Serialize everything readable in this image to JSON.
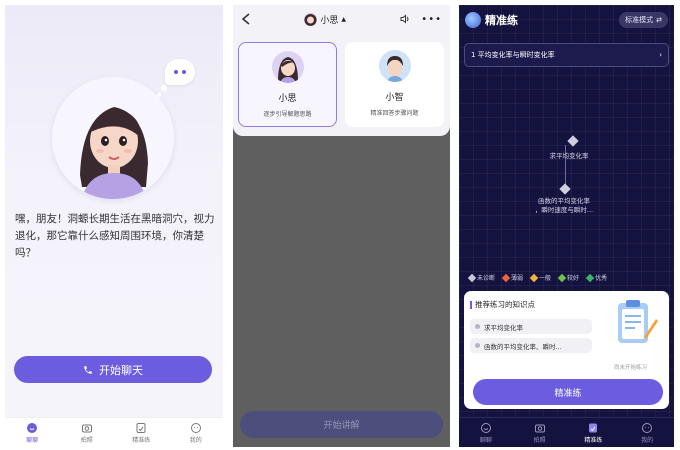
{
  "panel1": {
    "intro_text": "嘿，朋友！洞螈长期生活在黑暗洞穴，视力退化，那它靠什么感知周围环境，你清楚吗？",
    "start_chat_label": "开始聊天",
    "tabs": [
      {
        "label": "聊聊",
        "icon": "chat-icon",
        "active": true
      },
      {
        "label": "拍照",
        "icon": "camera-icon",
        "active": false
      },
      {
        "label": "精准练",
        "icon": "practice-icon",
        "active": false
      },
      {
        "label": "我的",
        "icon": "profile-icon",
        "active": false
      }
    ]
  },
  "panel2": {
    "nav_title": "小思",
    "tutors": [
      {
        "name": "小思",
        "desc": "逐步引导解题思路",
        "selected": true
      },
      {
        "name": "小智",
        "desc": "精准回答步骤问题",
        "selected": false
      }
    ],
    "start_label": "开始讲解"
  },
  "panel3": {
    "title": "精准练",
    "mode_label": "标准模式",
    "chapter": "1 平均变化率与瞬时变化率",
    "node1_label": "求平均变化率",
    "node2_label_line1": "函数的平均变化率",
    "node2_label_line2": "，瞬时速度与瞬时...",
    "legend": [
      {
        "label": "未诊断",
        "color": "#c9c9d6"
      },
      {
        "label": "薄弱",
        "color": "#e8643c"
      },
      {
        "label": "一般",
        "color": "#f0b63a"
      },
      {
        "label": "较好",
        "color": "#6cc24a"
      },
      {
        "label": "优秀",
        "color": "#39b36b"
      }
    ],
    "recommend_title": "推荐练习的知识点",
    "recommend_items": [
      "求平均变化率",
      "函数的平均变化率、瞬时..."
    ],
    "recommend_note": "尚未开始练习",
    "practice_button": "精准练",
    "tabs": [
      {
        "label": "聊聊",
        "icon": "chat-icon",
        "active": false
      },
      {
        "label": "拍照",
        "icon": "camera-icon",
        "active": false
      },
      {
        "label": "精准练",
        "icon": "practice-icon",
        "active": true
      },
      {
        "label": "我的",
        "icon": "profile-icon",
        "active": false
      }
    ]
  },
  "colors": {
    "accent": "#6b5ce0",
    "dark_bg": "#14123e"
  }
}
